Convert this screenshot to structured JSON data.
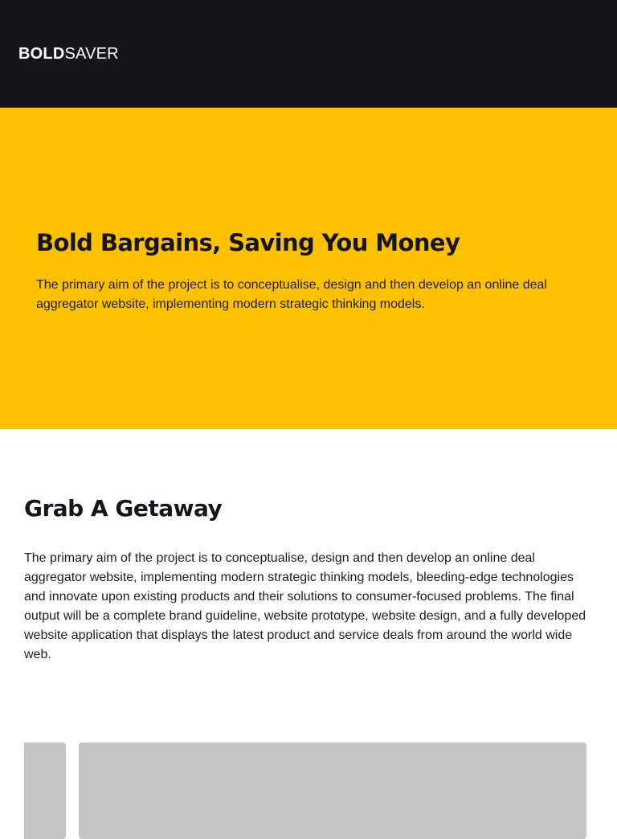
{
  "header": {
    "logo_bold": "BOLD",
    "logo_light": "SAVER"
  },
  "hero": {
    "title": "Bold Bargains, Saving You Money",
    "text": "The primary aim of the project is to conceptualise, design and then develop an online deal aggregator website, implementing modern strategic thinking models."
  },
  "getaway": {
    "title": "Grab A Getaway",
    "text": "The primary aim of the project is to conceptualise, design and then develop an online deal aggregator website, implementing modern strategic thinking models, bleeding-edge technologies and innovate upon existing products and their solutions to consumer-focused problems. The final output will be a complete brand guideline, website prototype, website design, and a fully developed website application that displays the latest product and service deals from around the world wide web."
  },
  "colors": {
    "header_bg": "#161618",
    "accent_yellow": "#fdc100",
    "placeholder_gray": "#c4c4c4"
  }
}
